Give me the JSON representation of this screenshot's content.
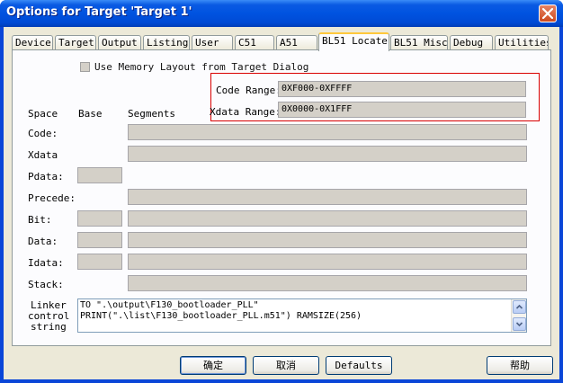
{
  "window": {
    "title": "Options for Target 'Target 1'"
  },
  "tabs": [
    {
      "label": "Device"
    },
    {
      "label": "Target"
    },
    {
      "label": "Output"
    },
    {
      "label": "Listing"
    },
    {
      "label": "User"
    },
    {
      "label": "C51"
    },
    {
      "label": "A51"
    },
    {
      "label": "BL51 Locate"
    },
    {
      "label": "BL51 Misc"
    },
    {
      "label": "Debug"
    },
    {
      "label": "Utilities"
    }
  ],
  "active_tab": "BL51 Locate",
  "use_memory_layout": {
    "label": "Use Memory Layout from Target Dialog",
    "checked": false
  },
  "code_range": {
    "label": "Code Range:",
    "value": "0XF000-0XFFFF"
  },
  "xdata_range": {
    "label": "Xdata Range:",
    "value": "0X0000-0X1FFF"
  },
  "columns": {
    "space": "Space",
    "base": "Base",
    "segments": "Segments"
  },
  "rows": {
    "code": {
      "label": "Code:"
    },
    "xdata": {
      "label": "Xdata"
    },
    "pdata": {
      "label": "Pdata:"
    },
    "precede": {
      "label": "Precede:"
    },
    "bit": {
      "label": "Bit:"
    },
    "data": {
      "label": "Data:"
    },
    "idata": {
      "label": "Idata:"
    },
    "stack": {
      "label": "Stack:"
    }
  },
  "linker": {
    "label_line1": "Linker",
    "label_line2": "control",
    "label_line3": "string",
    "line1": "TO \".\\output\\F130_bootloader_PLL\"",
    "line2": "PRINT(\".\\list\\F130_bootloader_PLL.m51\") RAMSIZE(256)"
  },
  "buttons": {
    "ok": "确定",
    "cancel": "取消",
    "defaults": "Defaults",
    "help": "帮助"
  }
}
